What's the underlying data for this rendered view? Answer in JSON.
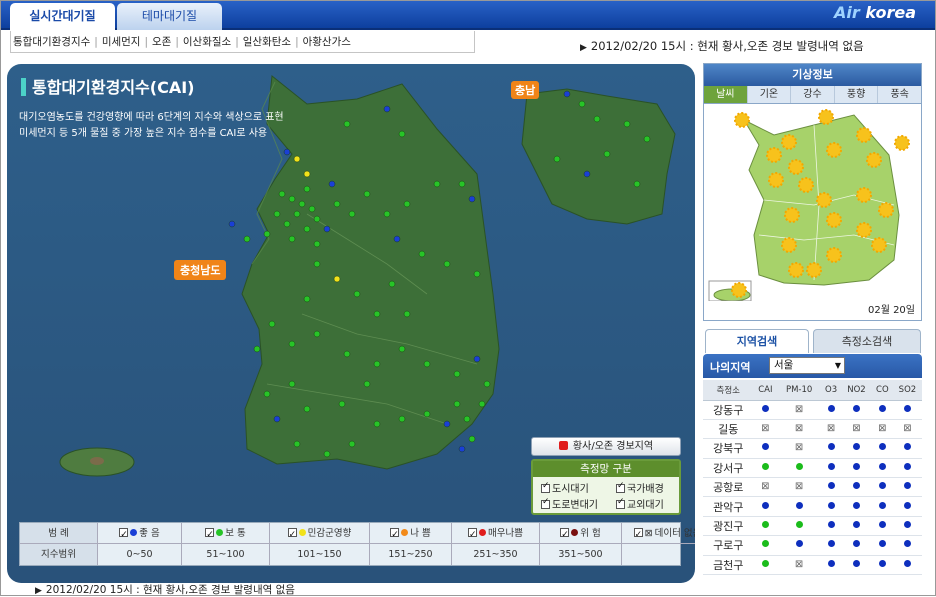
{
  "tabs": {
    "live": "실시간대기질",
    "theme": "테마대기질"
  },
  "logo": {
    "air": "Air",
    "korea": "korea"
  },
  "subnav": [
    "통합대기환경지수",
    "미세먼지",
    "오존",
    "이산화질소",
    "일산화탄소",
    "아황산가스"
  ],
  "notice": "2012/02/20 15시 : 현재 황사,오존 경보 발령내역 없음",
  "map": {
    "title": "통합대기환경지수(CAI)",
    "desc1": "대기오염농도를 건강영향에 따라 6단계의 지수와 색상으로 표현",
    "desc2": "미세먼지 등 5개 물질 중 가장 높은 지수 점수를 CAI로 사용",
    "badge_inset": "충남",
    "badge_region": "충청남도",
    "warning_button": "황사/오존 경보지역",
    "network": {
      "title": "측정망 구분",
      "items": [
        "도시대기",
        "국가배경",
        "도로변대기",
        "교외대기"
      ]
    }
  },
  "legend": {
    "row_labels": [
      "범 례",
      "지수범위"
    ],
    "items": [
      {
        "label": "좋 음",
        "range": "0~50",
        "color": "#1a3fd6"
      },
      {
        "label": "보 통",
        "range": "51~100",
        "color": "#27c427"
      },
      {
        "label": "민감군영향",
        "range": "101~150",
        "color": "#f2e21a"
      },
      {
        "label": "나 쁨",
        "range": "151~250",
        "color": "#f28a1a"
      },
      {
        "label": "매우나쁨",
        "range": "251~350",
        "color": "#e01d1d"
      },
      {
        "label": "위 험",
        "range": "351~500",
        "color": "#7a1010"
      },
      {
        "label": "데이터 없음",
        "range": "",
        "color": "none"
      }
    ]
  },
  "weather": {
    "title": "기상정보",
    "tabs": [
      "날씨",
      "기온",
      "강수",
      "풍향",
      "풍속"
    ],
    "active_tab": "날씨",
    "date": "02월 20일"
  },
  "search": {
    "tab_region": "지역검색",
    "tab_station": "측정소검색",
    "region_label": "나의지역",
    "region_value": "서울"
  },
  "table": {
    "headers": [
      "측정소",
      "CAI",
      "PM-10",
      "O3",
      "NO2",
      "CO",
      "SO2"
    ],
    "rows": [
      {
        "name": "강동구",
        "cells": [
          "vg",
          "na",
          "vg",
          "vg",
          "vg",
          "vg"
        ]
      },
      {
        "name": "길동",
        "cells": [
          "na",
          "na",
          "na",
          "na",
          "na",
          "na"
        ]
      },
      {
        "name": "강북구",
        "cells": [
          "vg",
          "na",
          "vg",
          "vg",
          "vg",
          "vg"
        ]
      },
      {
        "name": "강서구",
        "cells": [
          "good",
          "good",
          "vg",
          "vg",
          "vg",
          "vg"
        ]
      },
      {
        "name": "공항로",
        "cells": [
          "na",
          "na",
          "vg",
          "vg",
          "vg",
          "vg"
        ]
      },
      {
        "name": "관악구",
        "cells": [
          "vg",
          "vg",
          "vg",
          "vg",
          "vg",
          "vg"
        ]
      },
      {
        "name": "광진구",
        "cells": [
          "good",
          "good",
          "vg",
          "vg",
          "vg",
          "vg"
        ]
      },
      {
        "name": "구로구",
        "cells": [
          "good",
          "vg",
          "vg",
          "vg",
          "vg",
          "vg"
        ]
      },
      {
        "name": "금천구",
        "cells": [
          "good",
          "na",
          "vg",
          "vg",
          "vg",
          "vg"
        ]
      }
    ]
  }
}
